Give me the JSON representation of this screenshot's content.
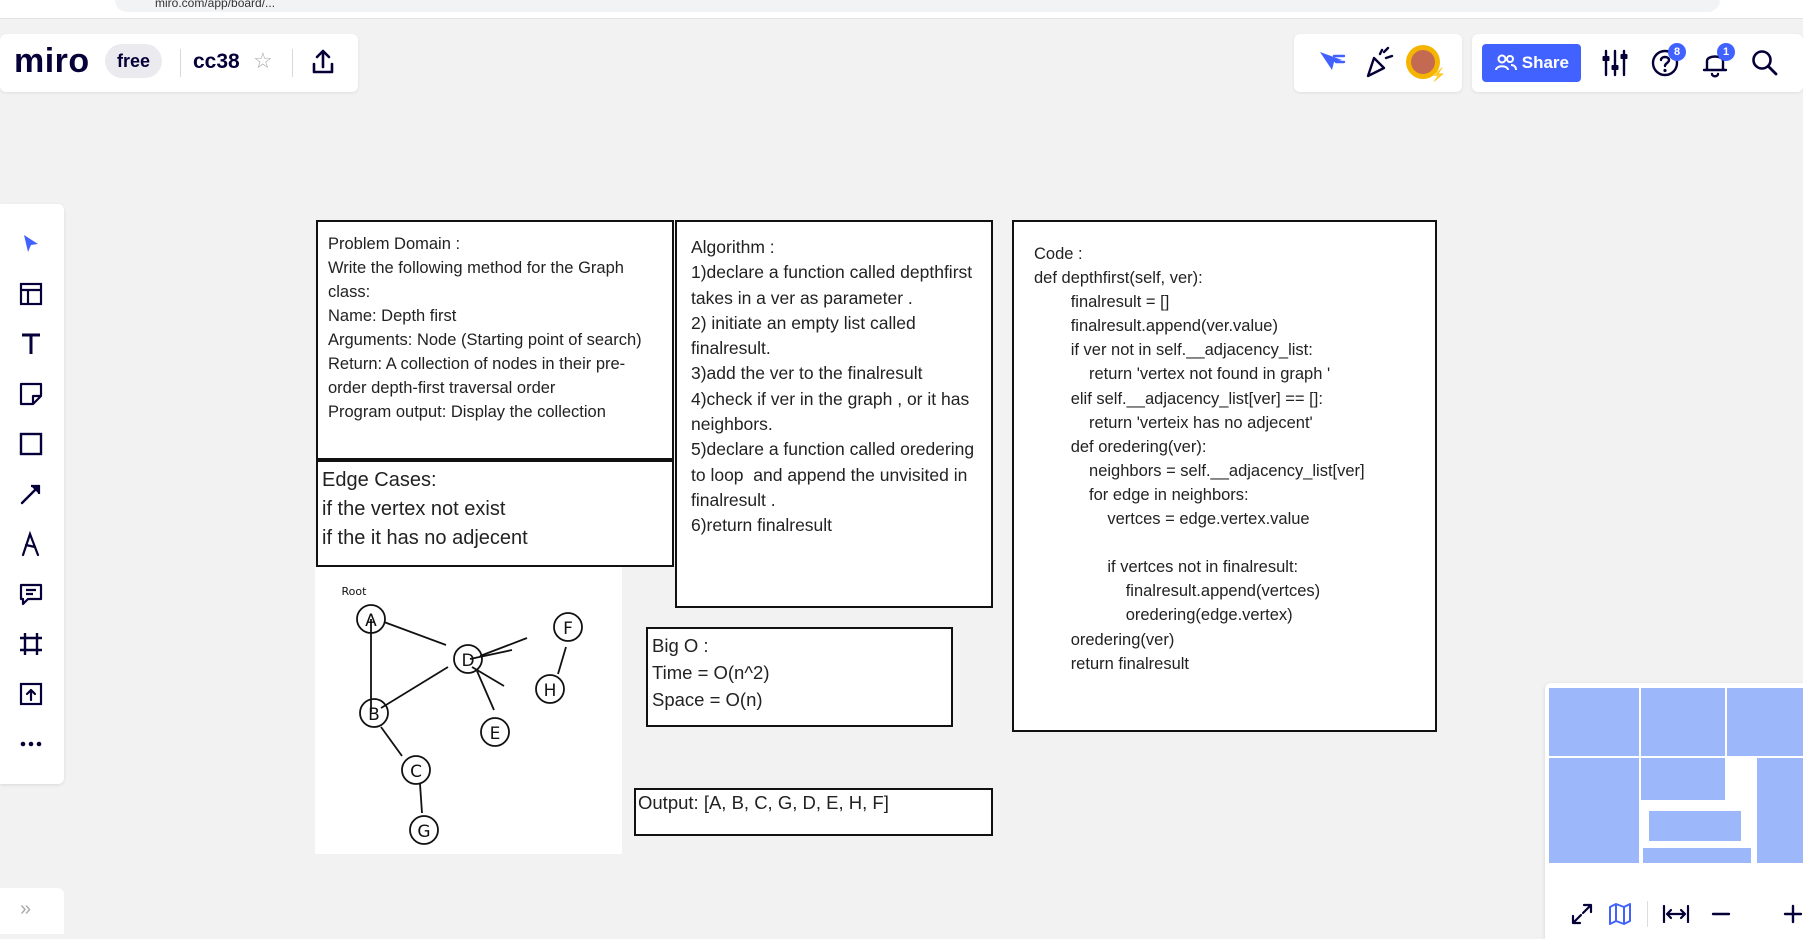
{
  "browser": {
    "url_fragment": "miro.com/app/board/..."
  },
  "header": {
    "logo": "miro",
    "plan_badge": "free",
    "board_name": "cc38",
    "share_label": "Share",
    "help_badge_count": "8",
    "notification_badge_count": "1"
  },
  "toolbar": {
    "tools": [
      "select",
      "templates",
      "text",
      "sticky-note",
      "shape",
      "connection-line",
      "pen",
      "comment",
      "frame",
      "upload",
      "more"
    ]
  },
  "board": {
    "problem_domain": "Problem Domain :\nWrite the following method for the Graph class:\nName: Depth first\nArguments: Node (Starting point of search)\nReturn: A collection of nodes in their pre-order depth-first traversal order\nProgram output: Display the collection",
    "edge_cases": "Edge Cases:\nif the vertex not exist\nif the it has no adjecent",
    "algorithm": "Algorithm :\n1)declare a function called depthfirst takes in a ver as parameter .\n2) initiate an empty list called finalresult.\n3)add the ver to the finalresult\n4)check if ver in the graph , or it has neighbors.\n5)declare a function called oredering to loop  and append the unvisited in finalresult .\n6)return finalresult",
    "code": "Code :\ndef depthfirst(self, ver):\n        finalresult = []\n        finalresult.append(ver.value)\n        if ver not in self.__adjacency_list:\n            return 'vertex not found in graph '\n        elif self.__adjacency_list[ver] == []:\n            return 'verteix has no adjecent'\n        def oredering(ver):\n            neighbors = self.__adjacency_list[ver]\n            for edge in neighbors:\n                vertces = edge.vertex.value\n\n                if vertces not in finalresult:\n                    finalresult.append(vertces)\n                    oredering(edge.vertex)\n        oredering(ver)\n        return finalresult",
    "big_o": "Big O :\nTime = O(n^2)\nSpace = O(n)",
    "output": "Output: [A, B, C, G, D, E, H, F]",
    "graph_image": {
      "root_label": "Root",
      "nodes": [
        "A",
        "B",
        "C",
        "D",
        "E",
        "F",
        "G",
        "H"
      ]
    }
  },
  "colors": {
    "accent": "#4262ff",
    "minimap_fill": "#9cb8fb",
    "canvas": "#f2f2f2"
  }
}
